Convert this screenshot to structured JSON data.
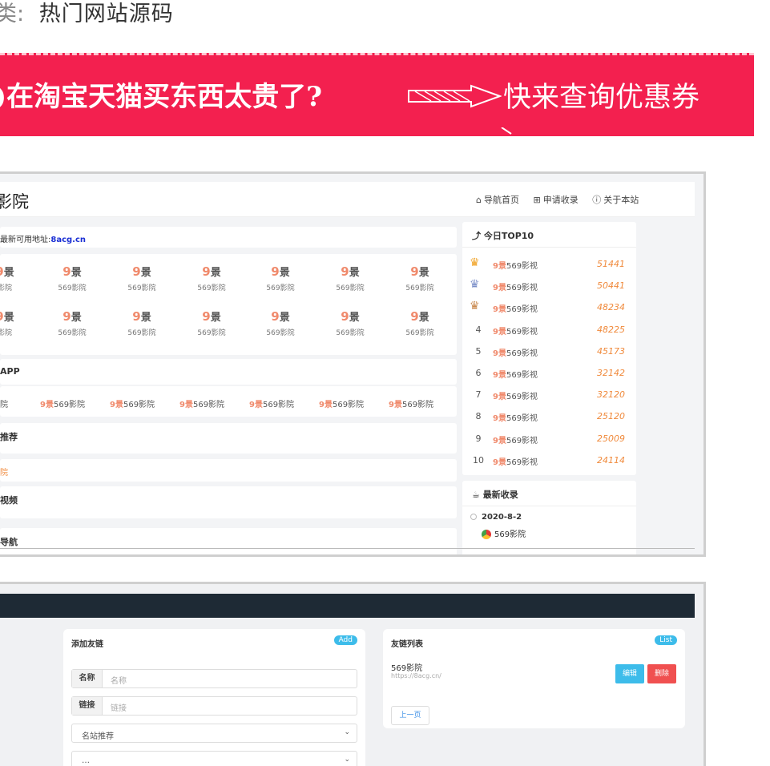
{
  "category": {
    "key": "类:",
    "value": "热门网站源码"
  },
  "banner": {
    "left_text": ")在淘宝天猫买东西太贵了?",
    "right_text": "快来查询优惠券"
  },
  "site": {
    "title": "影院",
    "nav": [
      {
        "icon": "home-icon",
        "label": "导航首页"
      },
      {
        "icon": "plus-square-icon",
        "label": "申请收录"
      },
      {
        "icon": "info-icon",
        "label": "关于本站"
      }
    ],
    "notice_prefix": "最新可用地址:",
    "notice_url": "8acg.cn",
    "grid_logo": "9",
    "grid_logo_suffix": "景",
    "grid_name": "569影院",
    "grid_row1_first_name": "影院",
    "sections": {
      "app": "APP",
      "recommend": "推荐",
      "video": "视频",
      "nav": "导航"
    },
    "app_items": [
      "影院",
      "569影院",
      "569影院",
      "569影院",
      "569影院",
      "569影院",
      "569影院"
    ],
    "app_logo": "9景",
    "hot_item": "院"
  },
  "top10": {
    "title": "今日TOP10",
    "label": "569影视",
    "logo": "9景",
    "items": [
      {
        "rank": "1",
        "score": "51441",
        "crown": "#f0a020"
      },
      {
        "rank": "2",
        "score": "50441",
        "crown": "#7a8ec8"
      },
      {
        "rank": "3",
        "score": "48234",
        "crown": "#c8864a"
      },
      {
        "rank": "4",
        "score": "48225"
      },
      {
        "rank": "5",
        "score": "45173"
      },
      {
        "rank": "6",
        "score": "32142"
      },
      {
        "rank": "7",
        "score": "32120"
      },
      {
        "rank": "8",
        "score": "25120"
      },
      {
        "rank": "9",
        "score": "25009"
      },
      {
        "rank": "10",
        "score": "24114"
      }
    ]
  },
  "latest": {
    "title": "最新收录",
    "date": "2020-8-2",
    "site": "569影院"
  },
  "admin": {
    "add_panel": {
      "title": "添加友链",
      "badge": "Add",
      "name_label": "名称",
      "name_placeholder": "名称",
      "link_label": "链接",
      "link_placeholder": "链接",
      "select_value": "名站推荐",
      "select2_value": "…"
    },
    "list_panel": {
      "title": "友链列表",
      "badge": "List",
      "item_name": "569影院",
      "item_url": "https://8acg.cn/",
      "edit": "编辑",
      "delete": "删除",
      "prev": "上一页"
    }
  },
  "colors": {
    "banner": "#f3204f",
    "accent": "#f08a6c",
    "score": "#f08a3c",
    "edit": "#3dbcea",
    "delete": "#f05050",
    "admin_bar": "#1e2a35"
  }
}
